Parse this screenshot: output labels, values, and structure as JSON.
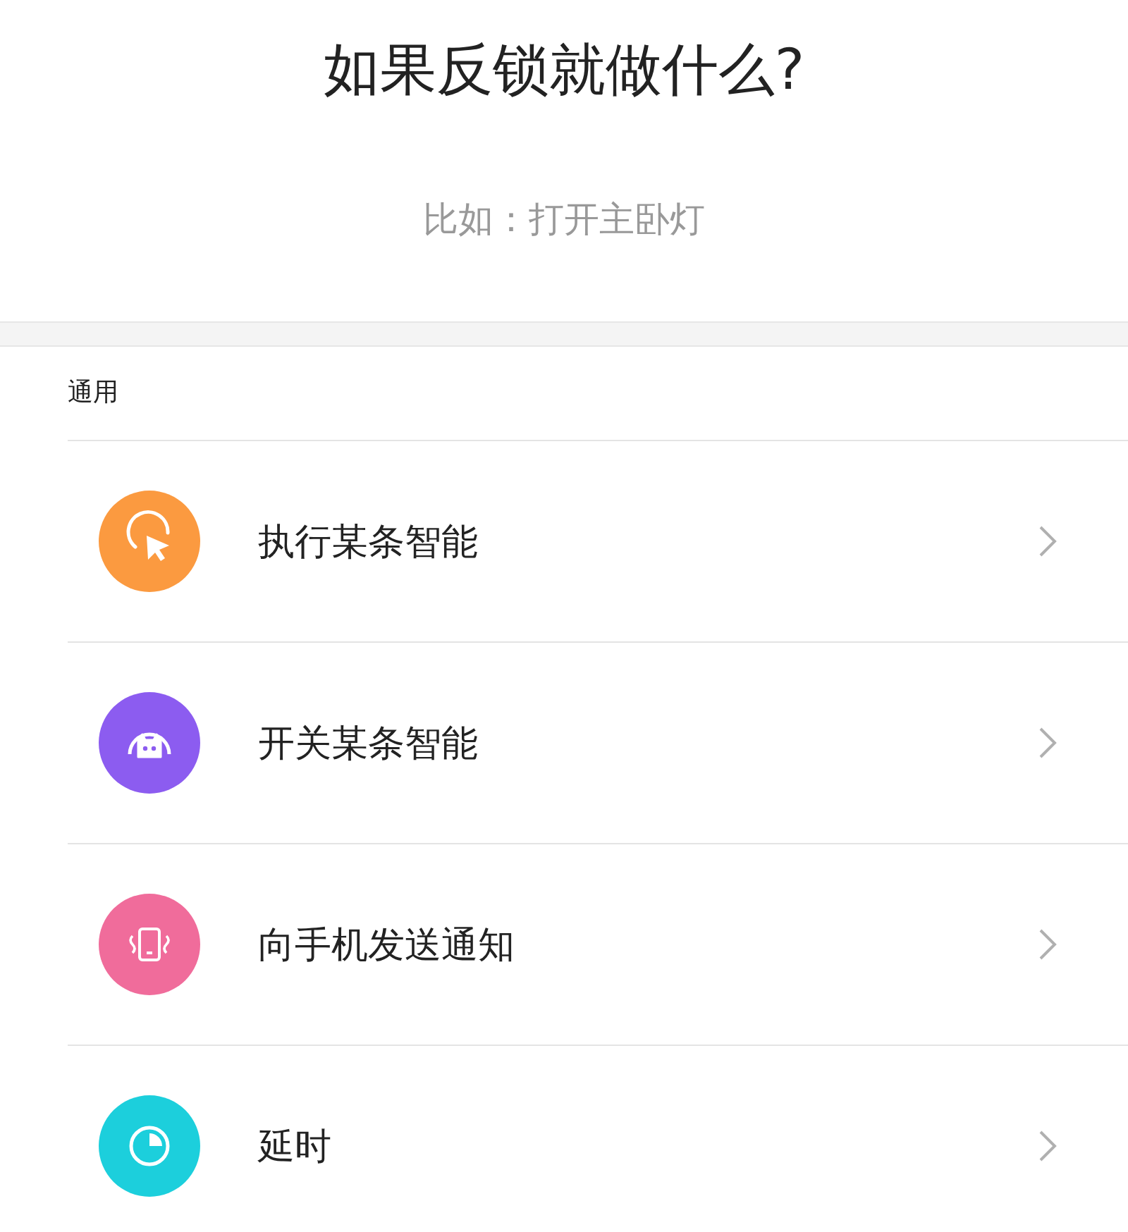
{
  "header": {
    "title": "如果反锁就做什么?",
    "example": "比如：打开主卧灯"
  },
  "section": {
    "label": "通用"
  },
  "actions": [
    {
      "label": "执行某条智能",
      "kind": "cursor",
      "color": "#fb9a40"
    },
    {
      "label": "开关某条智能",
      "kind": "robot",
      "color": "#8c5cf0"
    },
    {
      "label": "向手机发送通知",
      "kind": "phone",
      "color": "#f06c9b"
    },
    {
      "label": "延时",
      "kind": "timer",
      "color": "#1ccfdc"
    }
  ]
}
